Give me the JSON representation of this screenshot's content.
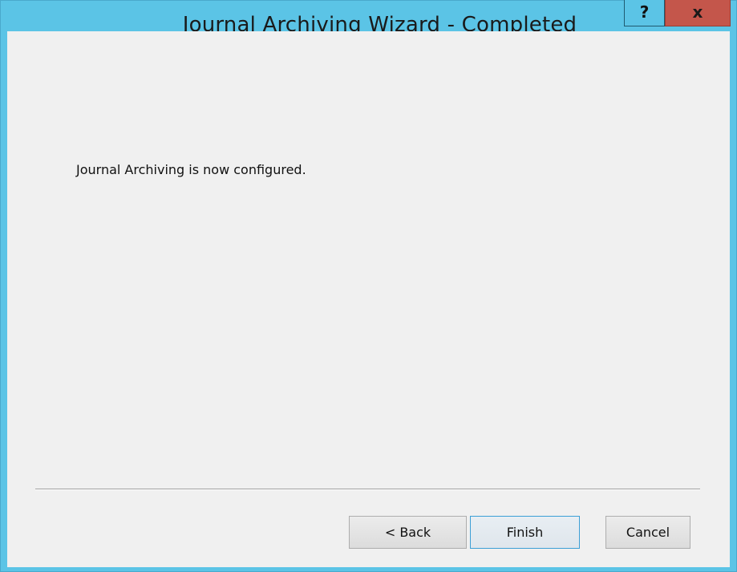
{
  "window": {
    "title": "Journal Archiving Wizard - Completed",
    "help_label": "?",
    "close_label": "x"
  },
  "content": {
    "message": "Journal Archiving is now configured."
  },
  "buttons": {
    "back_label": "< Back",
    "finish_label": "Finish",
    "cancel_label": "Cancel"
  },
  "colors": {
    "titlebar": "#5bc4e6",
    "close_button": "#c4564b",
    "client_background": "#f0f0f0",
    "default_button_border": "#3c9fd6"
  }
}
